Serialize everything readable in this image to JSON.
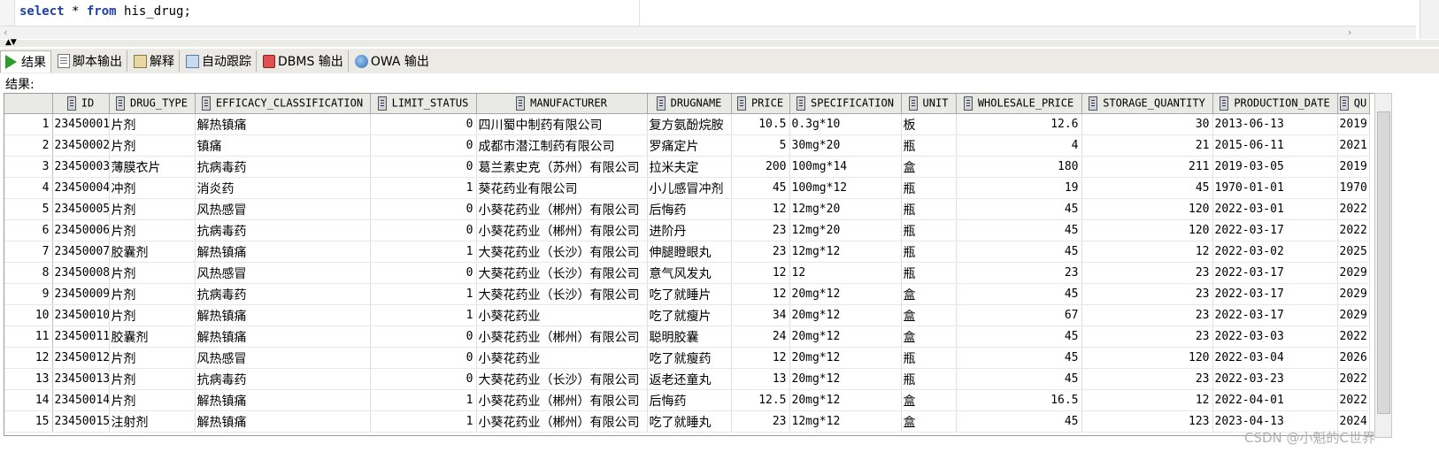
{
  "editor": {
    "sql_kw1": "select",
    "sql_mid": " * ",
    "sql_kw2": "from",
    "sql_rest": " his_drug;"
  },
  "tabs": [
    {
      "label": "结果",
      "icon": "play-icon"
    },
    {
      "label": "脚本输出",
      "icon": "script-output-icon"
    },
    {
      "label": "解释",
      "icon": "explain-icon"
    },
    {
      "label": "自动跟踪",
      "icon": "autotrace-icon"
    },
    {
      "label": "DBMS 输出",
      "icon": "dbms-output-icon"
    },
    {
      "label": "OWA 输出",
      "icon": "owa-output-icon"
    }
  ],
  "results_label": "结果:",
  "columns": [
    "ID",
    "DRUG_TYPE",
    "EFFICACY_CLASSIFICATION",
    "LIMIT_STATUS",
    "MANUFACTURER",
    "DRUGNAME",
    "PRICE",
    "SPECIFICATION",
    "UNIT",
    "WHOLESALE_PRICE",
    "STORAGE_QUANTITY",
    "PRODUCTION_DATE",
    "QU"
  ],
  "rows": [
    [
      "1",
      "23450001",
      "片剂",
      "解热镇痛",
      "0",
      "四川蜀中制药有限公司",
      "复方氨酚烷胺",
      "10.5",
      "0.3g*10",
      "板",
      "12.6",
      "30",
      "2013-06-13",
      "2019-"
    ],
    [
      "2",
      "23450002",
      "片剂",
      "镇痛",
      "0",
      "成都市潜江制药有限公司",
      "罗痛定片",
      "5",
      "30mg*20",
      "瓶",
      "4",
      "21",
      "2015-06-11",
      "2021-"
    ],
    [
      "3",
      "23450003",
      "薄膜衣片",
      "抗病毒药",
      "0",
      "葛兰素史克（苏州）有限公司",
      "拉米夫定",
      "200",
      "100mg*14",
      "盒",
      "180",
      "211",
      "2019-03-05",
      "2019-"
    ],
    [
      "4",
      "23450004",
      "冲剂",
      "消炎药",
      "1",
      "葵花药业有限公司",
      "小儿感冒冲剂",
      "45",
      "100mg*12",
      "瓶",
      "19",
      "45",
      "1970-01-01",
      "1970-"
    ],
    [
      "5",
      "23450005",
      "片剂",
      "风热感冒",
      "0",
      "小葵花药业（郴州）有限公司",
      "后悔药",
      "12",
      "12mg*20",
      "瓶",
      "45",
      "120",
      "2022-03-01",
      "2022-"
    ],
    [
      "6",
      "23450006",
      "片剂",
      "抗病毒药",
      "0",
      "小葵花药业（郴州）有限公司",
      "进阶丹",
      "23",
      "12mg*20",
      "瓶",
      "45",
      "120",
      "2022-03-17",
      "2022-"
    ],
    [
      "7",
      "23450007",
      "胶囊剂",
      "解热镇痛",
      "1",
      "大葵花药业（长沙）有限公司",
      "伸腿瞪眼丸",
      "23",
      "12mg*12",
      "瓶",
      "45",
      "12",
      "2022-03-02",
      "2025-"
    ],
    [
      "8",
      "23450008",
      "片剂",
      "风热感冒",
      "0",
      "大葵花药业（长沙）有限公司",
      "意气风发丸",
      "12",
      "12",
      "瓶",
      "23",
      "23",
      "2022-03-17",
      "2029-"
    ],
    [
      "9",
      "23450009",
      "片剂",
      "抗病毒药",
      "1",
      "大葵花药业（长沙）有限公司",
      "吃了就睡片",
      "12",
      "20mg*12",
      "盒",
      "45",
      "23",
      "2022-03-17",
      "2029-"
    ],
    [
      "10",
      "23450010",
      "片剂",
      "解热镇痛",
      "1",
      "小葵花药业",
      "吃了就瘦片",
      "34",
      "20mg*12",
      "盒",
      "67",
      "23",
      "2022-03-17",
      "2029-"
    ],
    [
      "11",
      "23450011",
      "胶囊剂",
      "解热镇痛",
      "0",
      "小葵花药业（郴州）有限公司",
      "聪明胶囊",
      "24",
      "20mg*12",
      "盒",
      "45",
      "23",
      "2022-03-03",
      "2022-"
    ],
    [
      "12",
      "23450012",
      "片剂",
      "风热感冒",
      "0",
      "小葵花药业",
      "吃了就瘦药",
      "12",
      "20mg*12",
      "瓶",
      "45",
      "120",
      "2022-03-04",
      "2026-"
    ],
    [
      "13",
      "23450013",
      "片剂",
      "抗病毒药",
      "0",
      "大葵花药业（长沙）有限公司",
      "返老还童丸",
      "13",
      "20mg*12",
      "瓶",
      "45",
      "23",
      "2022-03-23",
      "2022-"
    ],
    [
      "14",
      "23450014",
      "片剂",
      "解热镇痛",
      "1",
      "小葵花药业（郴州）有限公司",
      "后悔药",
      "12.5",
      "20mg*12",
      "盒",
      "16.5",
      "12",
      "2022-04-01",
      "2022-"
    ],
    [
      "15",
      "23450015",
      "注射剂",
      "解热镇痛",
      "1",
      "小葵花药业（郴州）有限公司",
      "吃了就睡丸",
      "23",
      "12mg*12",
      "盒",
      "45",
      "123",
      "2023-04-13",
      "2024-"
    ]
  ],
  "watermark": "CSDN @小魁的C世界"
}
